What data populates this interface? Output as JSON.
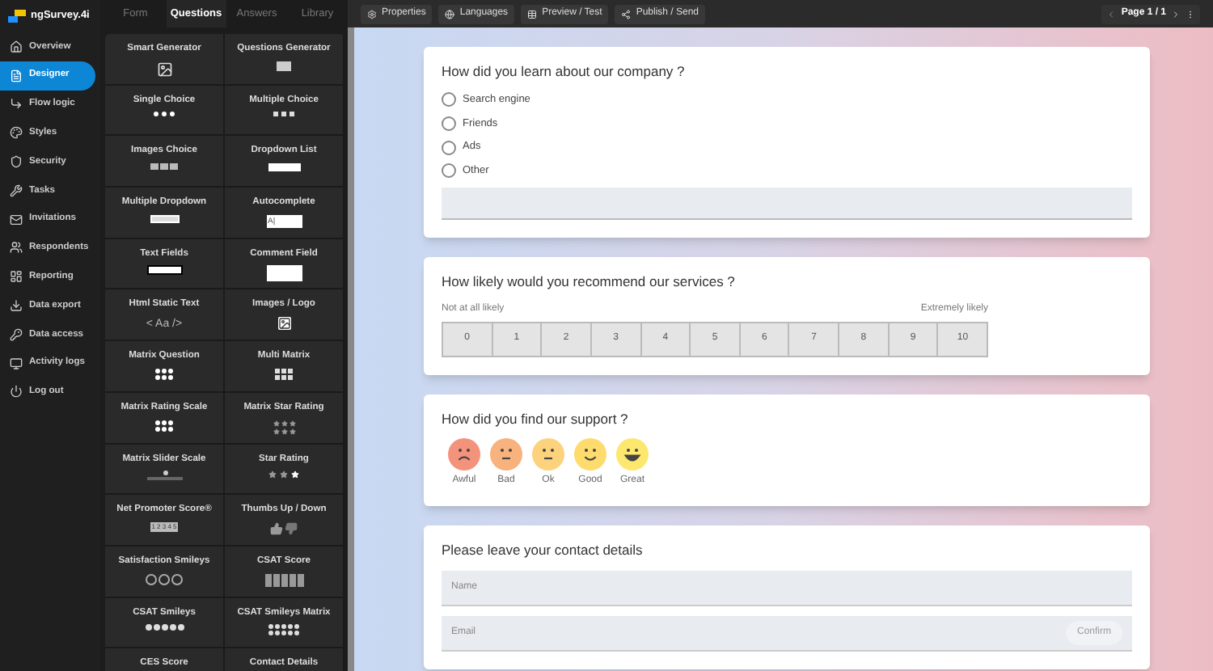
{
  "brand": {
    "name": "ngSurvey.4i"
  },
  "sidebar": {
    "items": [
      {
        "label": "Overview",
        "selected": false
      },
      {
        "label": "Designer",
        "selected": true
      },
      {
        "label": "Flow logic",
        "selected": false
      },
      {
        "label": "Styles",
        "selected": false
      },
      {
        "label": "Security",
        "selected": false
      },
      {
        "label": "Tasks",
        "selected": false
      },
      {
        "label": "Invitations",
        "selected": false
      },
      {
        "label": "Respondents",
        "selected": false
      },
      {
        "label": "Reporting",
        "selected": false
      },
      {
        "label": "Data export",
        "selected": false
      },
      {
        "label": "Data access",
        "selected": false
      },
      {
        "label": "Activity logs",
        "selected": false
      },
      {
        "label": "Log out",
        "selected": false
      }
    ]
  },
  "palette_tabs": [
    {
      "label": "Form",
      "selected": false
    },
    {
      "label": "Questions",
      "selected": true
    },
    {
      "label": "Answers",
      "selected": false
    },
    {
      "label": "Library",
      "selected": false
    }
  ],
  "palette": [
    {
      "label": "Smart Generator",
      "kind": "image"
    },
    {
      "label": "Questions Generator",
      "kind": "screen"
    },
    {
      "label": "Single Choice",
      "kind": "dots"
    },
    {
      "label": "Multiple Choice",
      "kind": "checks"
    },
    {
      "label": "Images Choice",
      "kind": "images"
    },
    {
      "label": "Dropdown List",
      "kind": "select"
    },
    {
      "label": "Multiple Dropdown",
      "kind": "multiselect"
    },
    {
      "label": "Autocomplete",
      "kind": "autocomplete",
      "preview_text": "A|"
    },
    {
      "label": "Text Fields",
      "kind": "field"
    },
    {
      "label": "Comment Field",
      "kind": "comment"
    },
    {
      "label": "Html Static Text",
      "kind": "code",
      "preview_text": "< Aa />"
    },
    {
      "label": "Images / Logo",
      "kind": "picture"
    },
    {
      "label": "Matrix Question",
      "kind": "dot-grid"
    },
    {
      "label": "Multi Matrix",
      "kind": "check-grid"
    },
    {
      "label": "Matrix Rating Scale",
      "kind": "dot-grid"
    },
    {
      "label": "Matrix Star Rating",
      "kind": "star-grid"
    },
    {
      "label": "Matrix Slider Scale",
      "kind": "slider"
    },
    {
      "label": "Star Rating",
      "kind": "stars"
    },
    {
      "label": "Net Promoter Score®",
      "kind": "numbers",
      "preview_text": "1 2 3 4 5"
    },
    {
      "label": "Thumbs Up / Down",
      "kind": "thumbs"
    },
    {
      "label": "Satisfaction Smileys",
      "kind": "smileys"
    },
    {
      "label": "CSAT Score",
      "kind": "bars"
    },
    {
      "label": "CSAT Smileys",
      "kind": "circle-row"
    },
    {
      "label": "CSAT Smileys Matrix",
      "kind": "circle-grid"
    },
    {
      "label": "CES Score",
      "kind": "none"
    },
    {
      "label": "Contact Details",
      "kind": "none"
    }
  ],
  "toolbar": [
    {
      "label": "Properties"
    },
    {
      "label": "Languages"
    },
    {
      "label": "Preview / Test"
    },
    {
      "label": "Publish / Send"
    }
  ],
  "pager": {
    "label": "Page 1 / 1"
  },
  "questions": [
    {
      "kind": "choice",
      "title": "How did you learn about our company ?",
      "options": [
        {
          "label": "Search engine",
          "selected": false
        },
        {
          "label": "Friends",
          "selected": false
        },
        {
          "label": "Ads",
          "selected": false
        },
        {
          "label": "Other",
          "selected": false
        }
      ]
    },
    {
      "kind": "scale",
      "title": "How likely would you recommend our services ?",
      "low_label": "Not at all likely",
      "high_label": "Extremely likely",
      "points": [
        {
          "label": "0",
          "selected": false
        },
        {
          "label": "1",
          "selected": false
        },
        {
          "label": "2",
          "selected": false
        },
        {
          "label": "3",
          "selected": false
        },
        {
          "label": "4",
          "selected": false
        },
        {
          "label": "5",
          "selected": false
        },
        {
          "label": "6",
          "selected": false
        },
        {
          "label": "7",
          "selected": false
        },
        {
          "label": "8",
          "selected": false
        },
        {
          "label": "9",
          "selected": false
        },
        {
          "label": "10",
          "selected": false
        }
      ]
    },
    {
      "kind": "smileys",
      "title": "How did you find our support ?",
      "faces": [
        {
          "label": "Awful",
          "kind": "frown",
          "color": "#f4937c"
        },
        {
          "label": "Bad",
          "kind": "flat",
          "color": "#f7b27e"
        },
        {
          "label": "Ok",
          "kind": "flat",
          "color": "#fcd27c"
        },
        {
          "label": "Good",
          "kind": "smile",
          "color": "#fddb6d"
        },
        {
          "label": "Great",
          "kind": "grin",
          "color": "#fde76e"
        }
      ]
    },
    {
      "kind": "contact",
      "title": "Please leave your contact details",
      "fields": [
        {
          "placeholder": "Name"
        },
        {
          "placeholder": "Email"
        }
      ],
      "button": {
        "label": "Confirm",
        "disabled": true
      }
    }
  ]
}
